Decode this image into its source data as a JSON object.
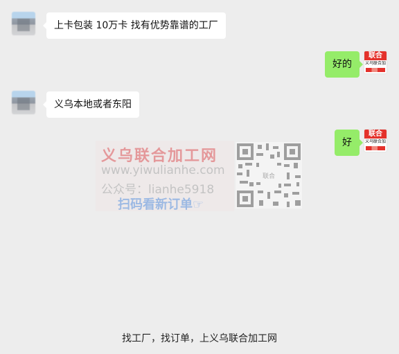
{
  "messages": [
    {
      "side": "in",
      "text": "上卡包装 10万卡  找有优势靠谱的工厂"
    },
    {
      "side": "out",
      "text": "好的"
    },
    {
      "side": "in",
      "text": "义乌本地或者东阳"
    },
    {
      "side": "out",
      "text": "好"
    }
  ],
  "brand_avatar": {
    "top": "联合",
    "middle": "义乌联合加工网"
  },
  "watermark": {
    "name": "义乌联合加工网",
    "url": "www.yiwulianhe.com",
    "account": "公众号：lianhe5918",
    "cta": "扫码看新订单☞",
    "qr_center": "联合"
  },
  "footer": "找工厂，找订单，上义乌联合加工网",
  "colors": {
    "background": "#ededed",
    "out_bubble": "#95ec69",
    "in_bubble": "#ffffff",
    "brand_red": "#e4312b"
  }
}
